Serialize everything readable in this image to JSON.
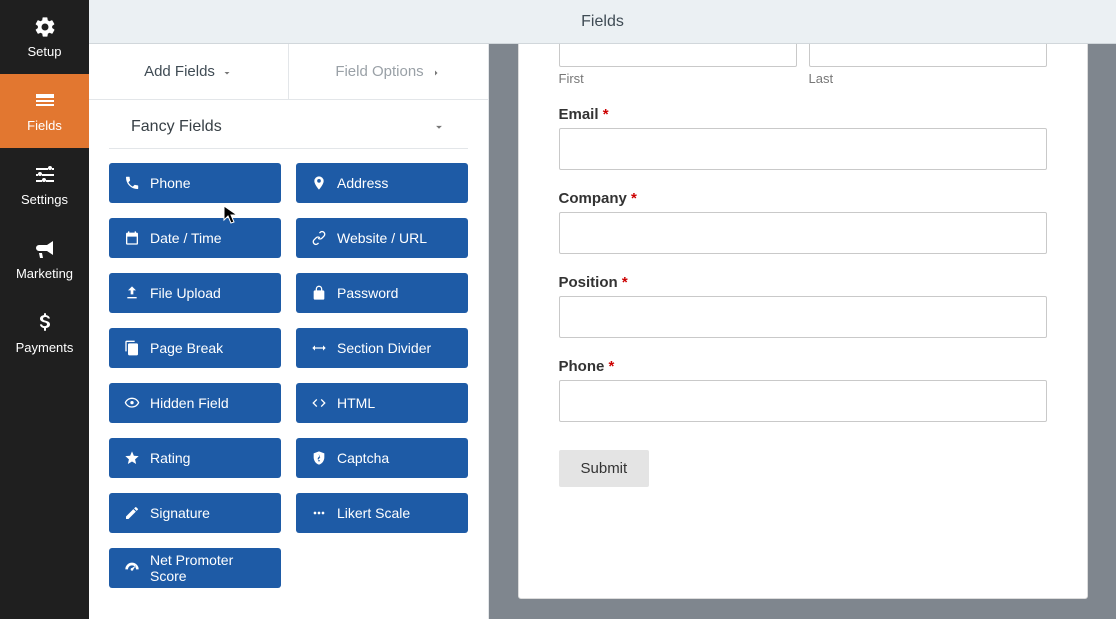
{
  "sidebar": {
    "items": [
      {
        "label": "Setup"
      },
      {
        "label": "Fields"
      },
      {
        "label": "Settings"
      },
      {
        "label": "Marketing"
      },
      {
        "label": "Payments"
      }
    ]
  },
  "header": {
    "title": "Fields"
  },
  "tabs": {
    "add_fields": "Add Fields",
    "field_options": "Field Options"
  },
  "section_title": "Fancy Fields",
  "fields": [
    {
      "label": "Phone"
    },
    {
      "label": "Address"
    },
    {
      "label": "Date / Time"
    },
    {
      "label": "Website / URL"
    },
    {
      "label": "File Upload"
    },
    {
      "label": "Password"
    },
    {
      "label": "Page Break"
    },
    {
      "label": "Section Divider"
    },
    {
      "label": "Hidden Field"
    },
    {
      "label": "HTML"
    },
    {
      "label": "Rating"
    },
    {
      "label": "Captcha"
    },
    {
      "label": "Signature"
    },
    {
      "label": "Likert Scale"
    },
    {
      "label": "Net Promoter Score"
    }
  ],
  "form": {
    "name_first_sub": "First",
    "name_last_sub": "Last",
    "email_label": "Email",
    "company_label": "Company",
    "position_label": "Position",
    "phone_label": "Phone",
    "submit_label": "Submit"
  }
}
